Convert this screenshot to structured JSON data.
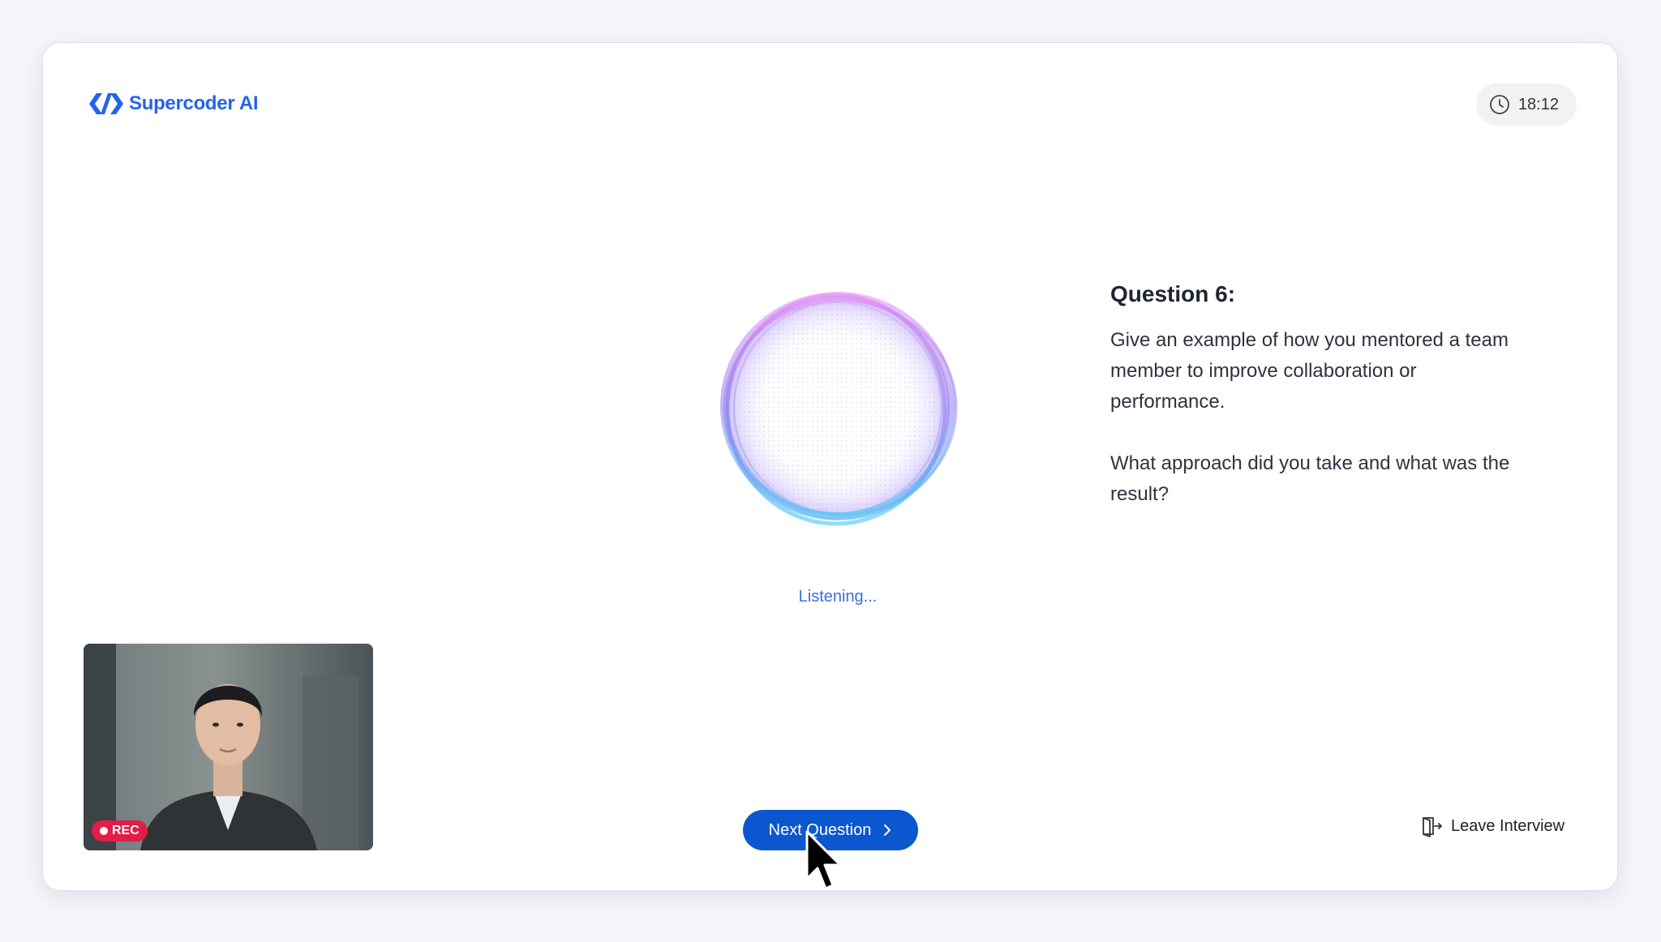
{
  "brand": {
    "name": "Supercoder AI",
    "color": "#2563eb"
  },
  "timer": {
    "icon": "clock-icon",
    "value": "18:12"
  },
  "assistant": {
    "status": "Listening..."
  },
  "question": {
    "title": "Question 6:",
    "paragraphs": [
      "Give an example of how you mentored a team member to improve collaboration or performance.",
      "What approach did you take and what was the result?"
    ]
  },
  "video": {
    "rec_label": "REC",
    "rec_color": "#e11d48"
  },
  "actions": {
    "next_label": "Next Question",
    "next_color": "#0b57d0",
    "leave_label": "Leave Interview"
  }
}
